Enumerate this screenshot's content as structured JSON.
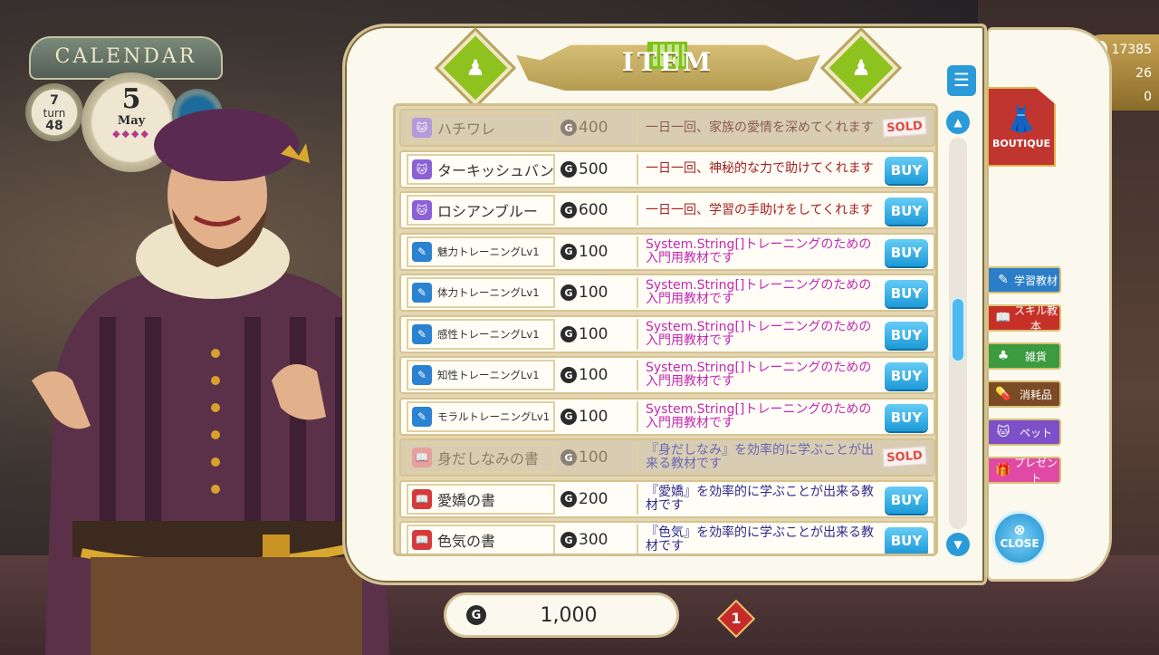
{
  "calendar": {
    "title": "CALENDAR",
    "turn_current": "7",
    "turn_label": "turn",
    "turn_total": "48",
    "day": "5",
    "month": "May",
    "dots": "◆◆◆◆"
  },
  "hud": {
    "info_value": "17385",
    "warn_value": "26",
    "alert_value": "0"
  },
  "panel": {
    "title": "ITEM"
  },
  "items": [
    {
      "name": "ハチワレ",
      "icon": "cat-icon",
      "price": "400",
      "desc": "一日一回、家族の愛情を深めてくれます",
      "desc_color": "red",
      "status": "SOLD"
    },
    {
      "name": "ターキッシュバン",
      "icon": "cat-icon",
      "price": "500",
      "desc": "一日一回、神秘的な力で助けてくれます",
      "desc_color": "red",
      "status": "BUY"
    },
    {
      "name": "ロシアンブルー",
      "icon": "cat-icon",
      "price": "600",
      "desc": "一日一回、学習の手助けをしてくれます",
      "desc_color": "red",
      "status": "BUY"
    },
    {
      "name": "魅力トレーニングLv1",
      "icon": "study-icon",
      "price": "100",
      "desc": "System.String[]トレーニングのための入門用教材です",
      "desc_color": "purple",
      "status": "BUY"
    },
    {
      "name": "体力トレーニングLv1",
      "icon": "study-icon",
      "price": "100",
      "desc": "System.String[]トレーニングのための入門用教材です",
      "desc_color": "purple",
      "status": "BUY"
    },
    {
      "name": "感性トレーニングLv1",
      "icon": "study-icon",
      "price": "100",
      "desc": "System.String[]トレーニングのための入門用教材です",
      "desc_color": "purple",
      "status": "BUY"
    },
    {
      "name": "知性トレーニングLv1",
      "icon": "study-icon",
      "price": "100",
      "desc": "System.String[]トレーニングのための入門用教材です",
      "desc_color": "purple",
      "status": "BUY"
    },
    {
      "name": "モラルトレーニングLv1",
      "icon": "study-icon",
      "price": "100",
      "desc": "System.String[]トレーニングのための入門用教材です",
      "desc_color": "purple",
      "status": "BUY"
    },
    {
      "name": "身だしなみの書",
      "icon": "book-icon",
      "price": "100",
      "desc": "『身だしなみ』を効率的に学ぶことが出来る教材です",
      "desc_color": "navy",
      "status": "SOLD"
    },
    {
      "name": "愛嬌の書",
      "icon": "book-icon",
      "price": "200",
      "desc": "『愛嬌』を効率的に学ぶことが出来る教材です",
      "desc_color": "navy",
      "status": "BUY"
    },
    {
      "name": "色気の書",
      "icon": "book-icon",
      "price": "300",
      "desc": "『色気』を効率的に学ぶことが出来る教材です",
      "desc_color": "navy",
      "status": "BUY"
    }
  ],
  "sidebar": {
    "boutique_label": "BOUTIQUE",
    "categories": [
      {
        "label": "学習教材",
        "icon": "study-icon"
      },
      {
        "label": "スキル教本",
        "icon": "book-icon"
      },
      {
        "label": "雑貨",
        "icon": "goods-icon"
      },
      {
        "label": "消耗品",
        "icon": "pill-icon"
      },
      {
        "label": "ペット",
        "icon": "cat-icon"
      },
      {
        "label": "プレゼント",
        "icon": "gift-icon"
      }
    ],
    "close_label": "CLOSE"
  },
  "wallet": {
    "currency_symbol": "G",
    "amount": "1,000"
  },
  "notification": {
    "count": "1"
  },
  "colors": {
    "buy": "#1c9ad8",
    "sold": "#e04a3f",
    "desc_red": "#a5201f",
    "desc_purple": "#c328b4",
    "desc_navy": "#2e2a8e"
  }
}
